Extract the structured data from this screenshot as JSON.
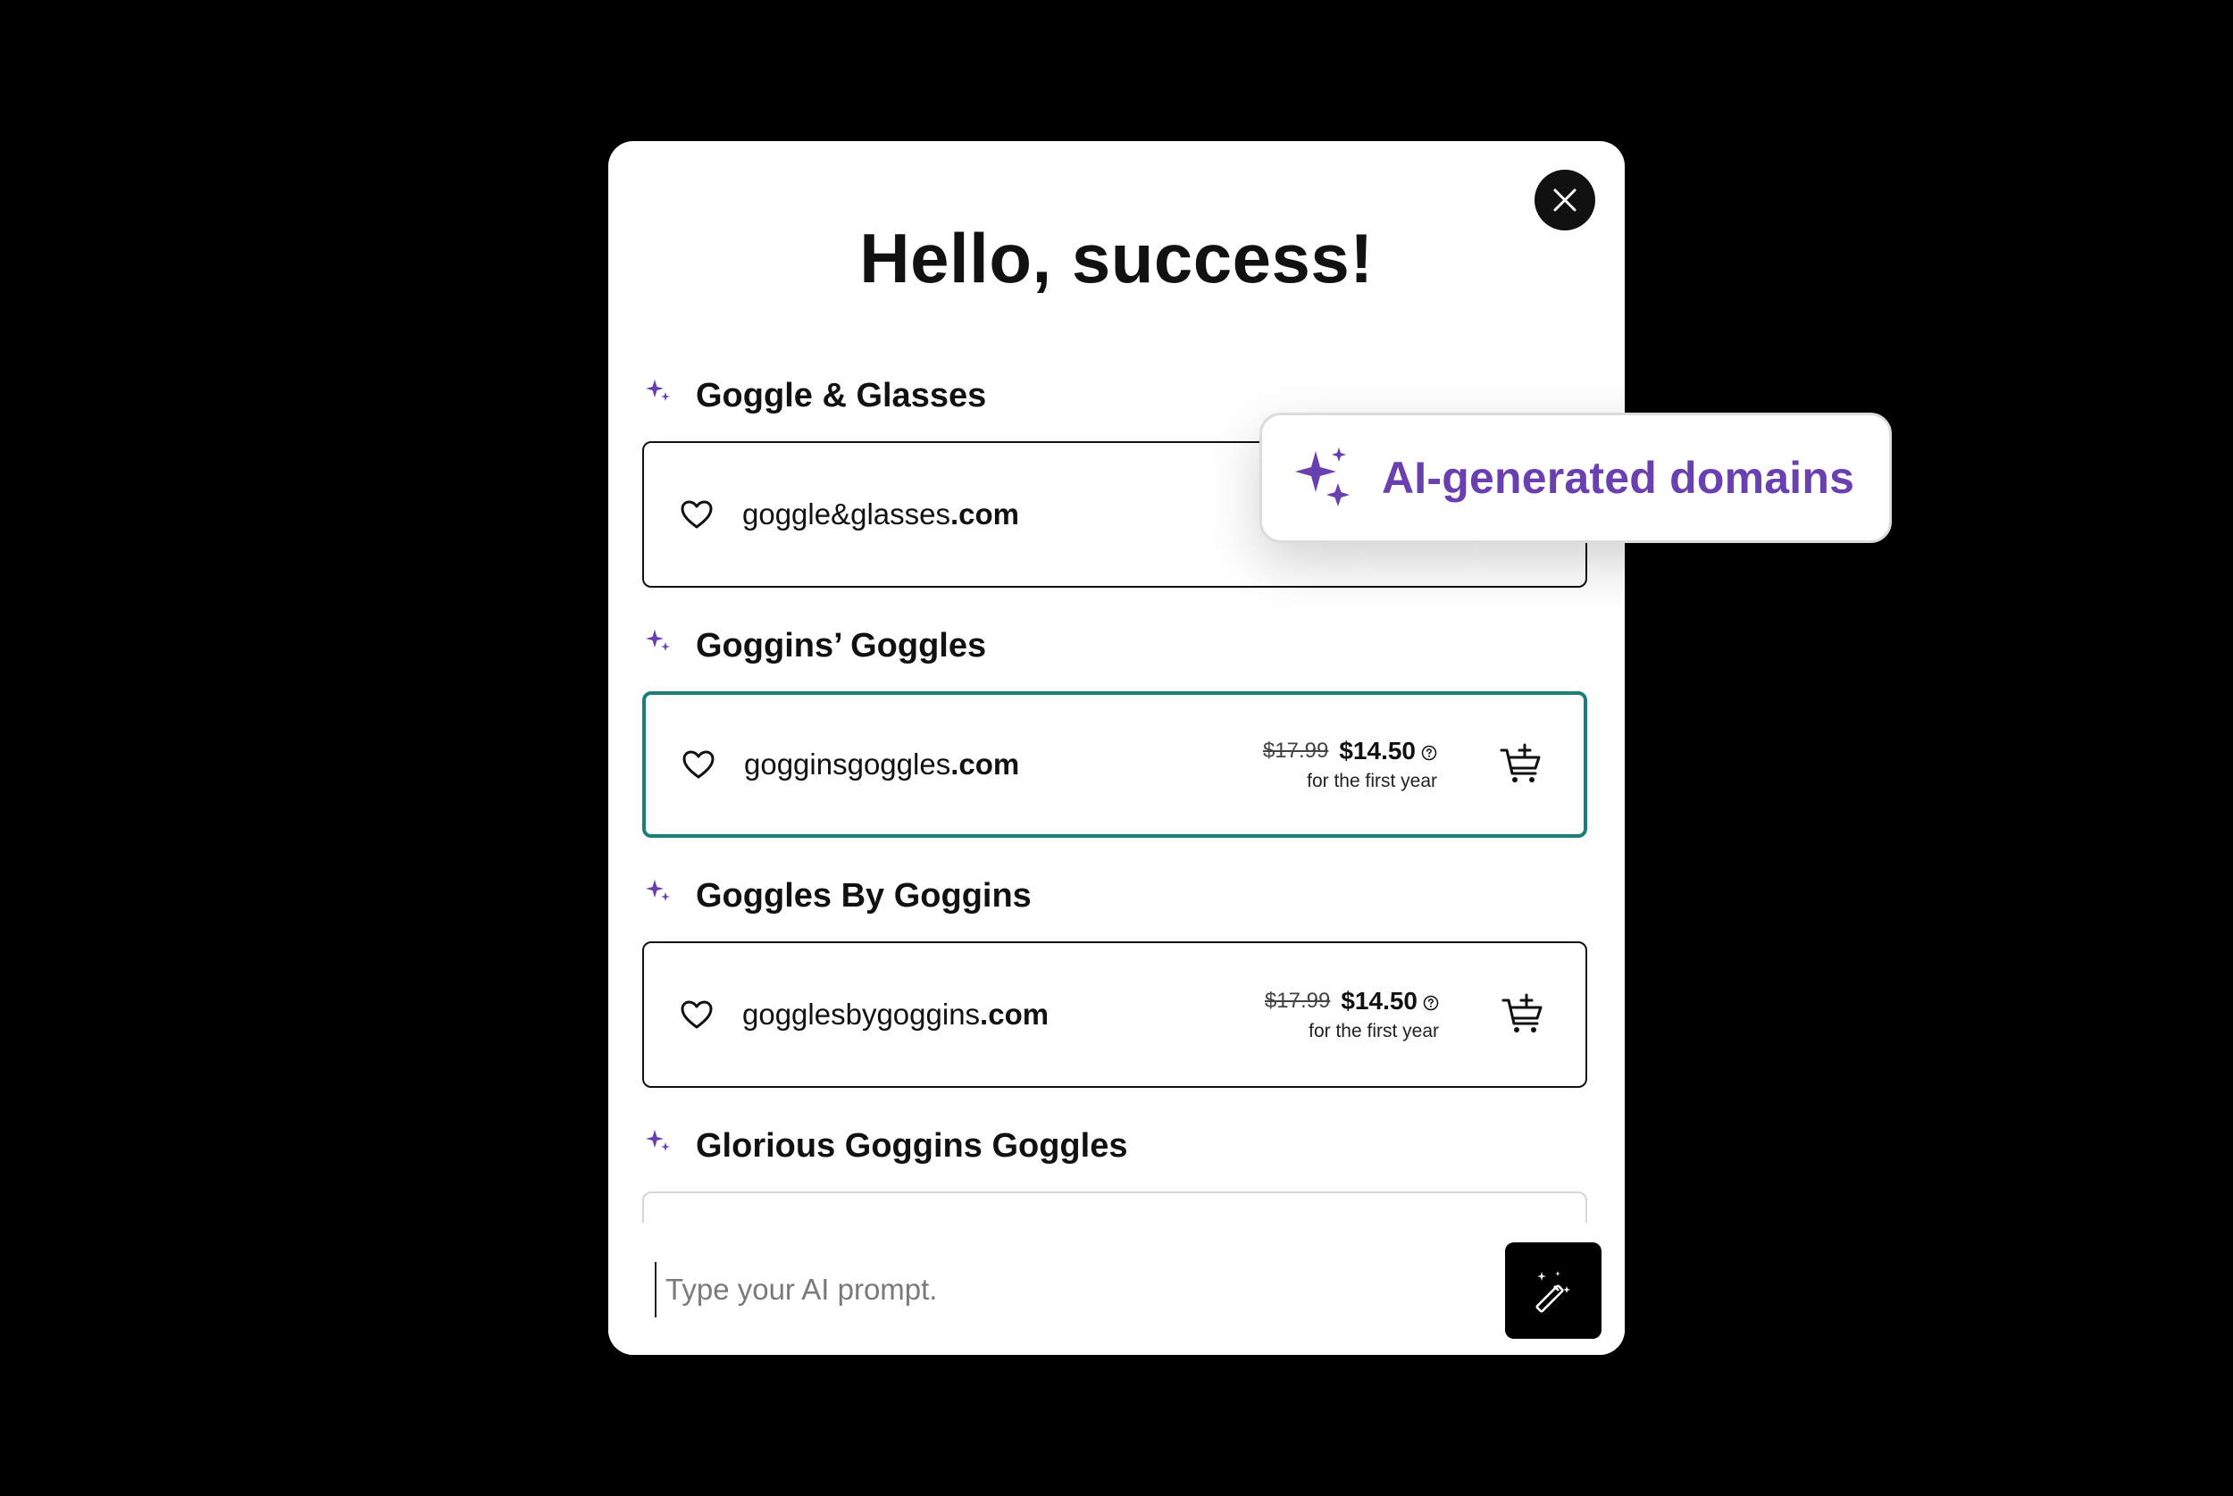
{
  "modal": {
    "title": "Hello, success!",
    "close_icon": "close-icon"
  },
  "colors": {
    "accent_purple": "#6a3fb0",
    "selected_border": "#1b7f7a",
    "background": "#000000"
  },
  "groups": [
    {
      "label": "Goggle & Glasses",
      "domain_name": "goggle&glasses",
      "domain_tld": ".com",
      "old_price": "",
      "new_price": "",
      "price_note": ""
    },
    {
      "label": "Goggins’ Goggles",
      "domain_name": "gogginsgoggles",
      "domain_tld": ".com",
      "old_price": "$17.99",
      "new_price": "$14.50",
      "price_note": "for the first year"
    },
    {
      "label": "Goggles By Goggins",
      "domain_name": "gogglesbygoggins",
      "domain_tld": ".com",
      "old_price": "$17.99",
      "new_price": "$14.50",
      "price_note": "for the first year"
    },
    {
      "label": "Glorious Goggins Goggles"
    }
  ],
  "prompt": {
    "placeholder": "Type your AI prompt.",
    "value": ""
  },
  "badge": {
    "label": "AI-generated domains"
  }
}
